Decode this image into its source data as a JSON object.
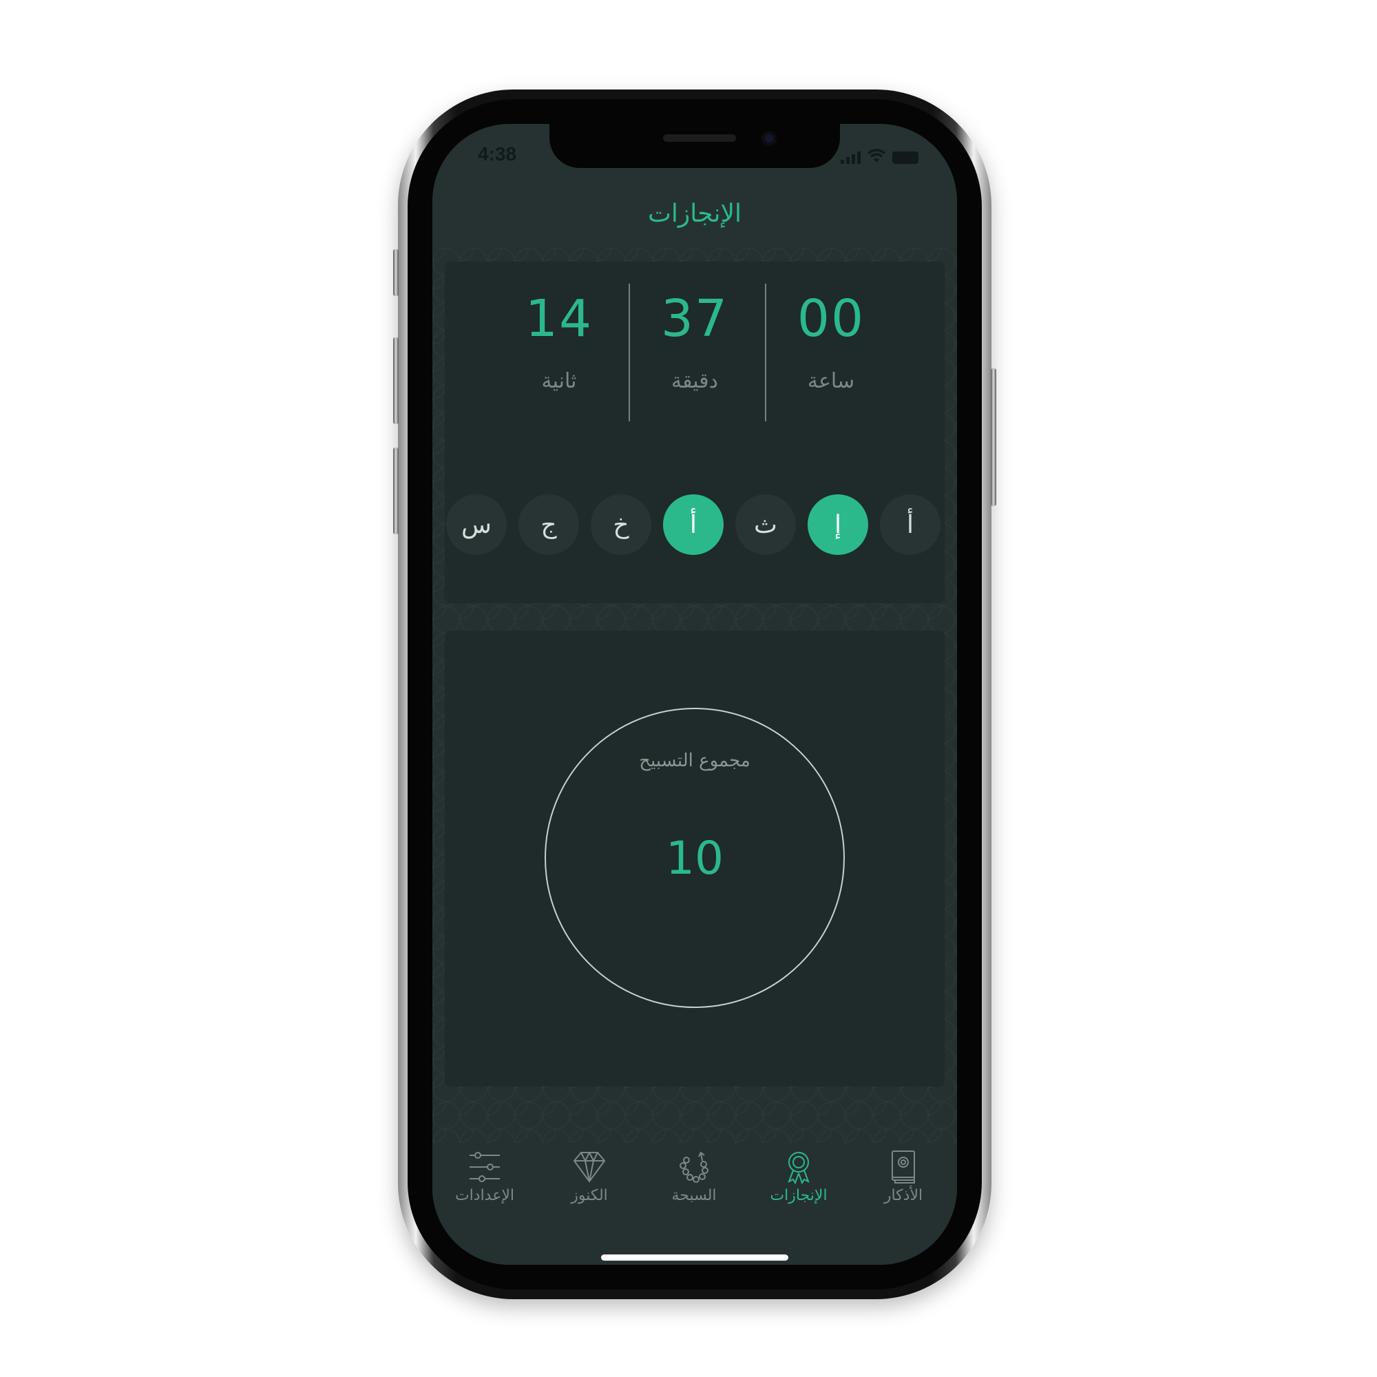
{
  "status": {
    "time": "4:38"
  },
  "header": {
    "title": "الإنجازات"
  },
  "timer": {
    "seconds": {
      "value": "14",
      "label": "ثانية"
    },
    "minutes": {
      "value": "37",
      "label": "دقيقة"
    },
    "hours": {
      "value": "00",
      "label": "ساعة"
    }
  },
  "days": [
    {
      "label": "س",
      "active": false
    },
    {
      "label": "ج",
      "active": false
    },
    {
      "label": "خ",
      "active": false
    },
    {
      "label": "أ",
      "active": true
    },
    {
      "label": "ث",
      "active": false
    },
    {
      "label": "إ",
      "active": true
    },
    {
      "label": "أ",
      "active": false
    }
  ],
  "total": {
    "label": "مجموع التسبيح",
    "value": "10"
  },
  "tabs": [
    {
      "label": "الإعدادات",
      "icon": "sliders-icon",
      "active": false
    },
    {
      "label": "الكنوز",
      "icon": "diamond-icon",
      "active": false
    },
    {
      "label": "السبحة",
      "icon": "prayer-beads-icon",
      "active": false
    },
    {
      "label": "الإنجازات",
      "icon": "award-icon",
      "active": true
    },
    {
      "label": "الأذكار",
      "icon": "book-icon",
      "active": false
    }
  ],
  "colors": {
    "accent": "#2bb98c",
    "background": "#263231",
    "card": "#1f2a2a"
  }
}
